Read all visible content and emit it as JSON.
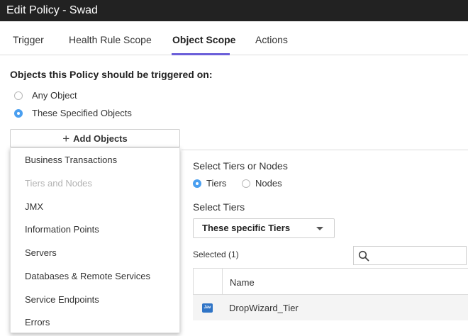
{
  "window": {
    "title": "Edit Policy - Swad"
  },
  "tabs": [
    {
      "label": "Trigger",
      "active": false
    },
    {
      "label": "Health Rule Scope",
      "active": false
    },
    {
      "label": "Object Scope",
      "active": true
    },
    {
      "label": "Actions",
      "active": false
    }
  ],
  "object_scope": {
    "heading": "Objects this Policy should be triggered on:",
    "options": [
      {
        "label": "Any Object",
        "checked": false
      },
      {
        "label": "These Specified Objects",
        "checked": true
      }
    ],
    "add_button": {
      "icon": "plus-icon",
      "label": "Add Objects"
    }
  },
  "add_objects_menu": {
    "items": [
      {
        "label": "Business Transactions",
        "enabled": true
      },
      {
        "label": "Tiers and Nodes",
        "enabled": false
      },
      {
        "label": "JMX",
        "enabled": true
      },
      {
        "label": "Information Points",
        "enabled": true
      },
      {
        "label": "Servers",
        "enabled": true
      },
      {
        "label": "Databases & Remote Services",
        "enabled": true
      },
      {
        "label": "Service Endpoints",
        "enabled": true
      },
      {
        "label": "Errors",
        "enabled": true
      }
    ]
  },
  "tiers_panel": {
    "select_label": "Select Tiers or Nodes",
    "type_options": [
      {
        "label": "Tiers",
        "checked": true
      },
      {
        "label": "Nodes",
        "checked": false
      }
    ],
    "select_tiers_label": "Select Tiers",
    "tiers_dropdown": {
      "value": "These specific Tiers"
    },
    "selected_label": "Selected (1)",
    "search": {
      "placeholder": "",
      "value": "",
      "icon": "search-icon"
    },
    "table": {
      "columns": [
        "Name"
      ],
      "rows": [
        {
          "icon": "java-icon",
          "icon_text": "Jav",
          "name": "DropWizard_Tier"
        }
      ]
    }
  },
  "colors": {
    "titlebar_bg": "#222222",
    "active_tab_underline": "#6b5fd9",
    "radio_checked": "#4a9ff0",
    "java_icon": "#2f74c6"
  }
}
